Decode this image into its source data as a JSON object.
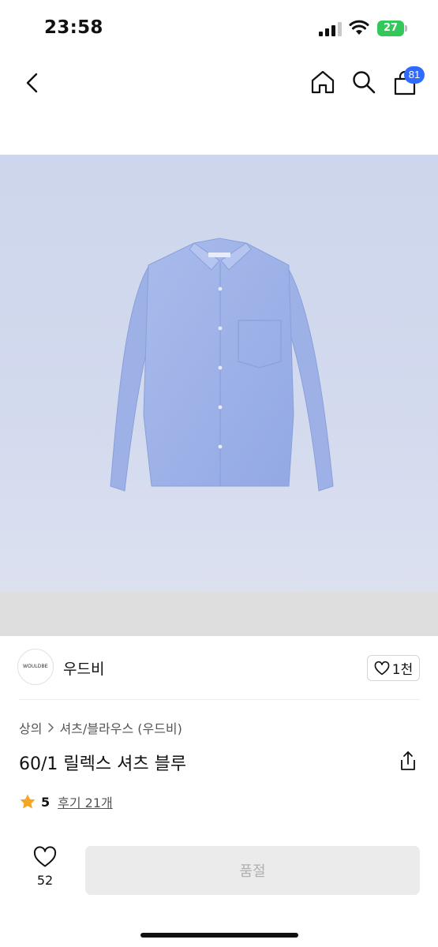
{
  "status_bar": {
    "time": "23:58",
    "battery": "27"
  },
  "header": {
    "cart_count": "81"
  },
  "brand": {
    "logo_text": "WOULDBE",
    "name": "우드비",
    "likes": "1천"
  },
  "breadcrumb": {
    "category": "상의",
    "subcategory": "셔츠/블라우스 (우드비)"
  },
  "product": {
    "title": "60/1 릴렉스 셔츠 블루",
    "rating": "5",
    "reviews_label": "후기 21개",
    "image_alt": "light blue button-up shirt"
  },
  "bottom_bar": {
    "wishlist_count": "52",
    "purchase_label": "품절"
  },
  "colors": {
    "accent": "#2f6bff",
    "star": "#f5a623",
    "battery": "#34c759",
    "soldout_bg": "#ebebeb"
  },
  "icons": [
    "back-icon",
    "home-icon",
    "search-icon",
    "cart-icon",
    "heart-icon",
    "share-icon",
    "star-icon"
  ]
}
